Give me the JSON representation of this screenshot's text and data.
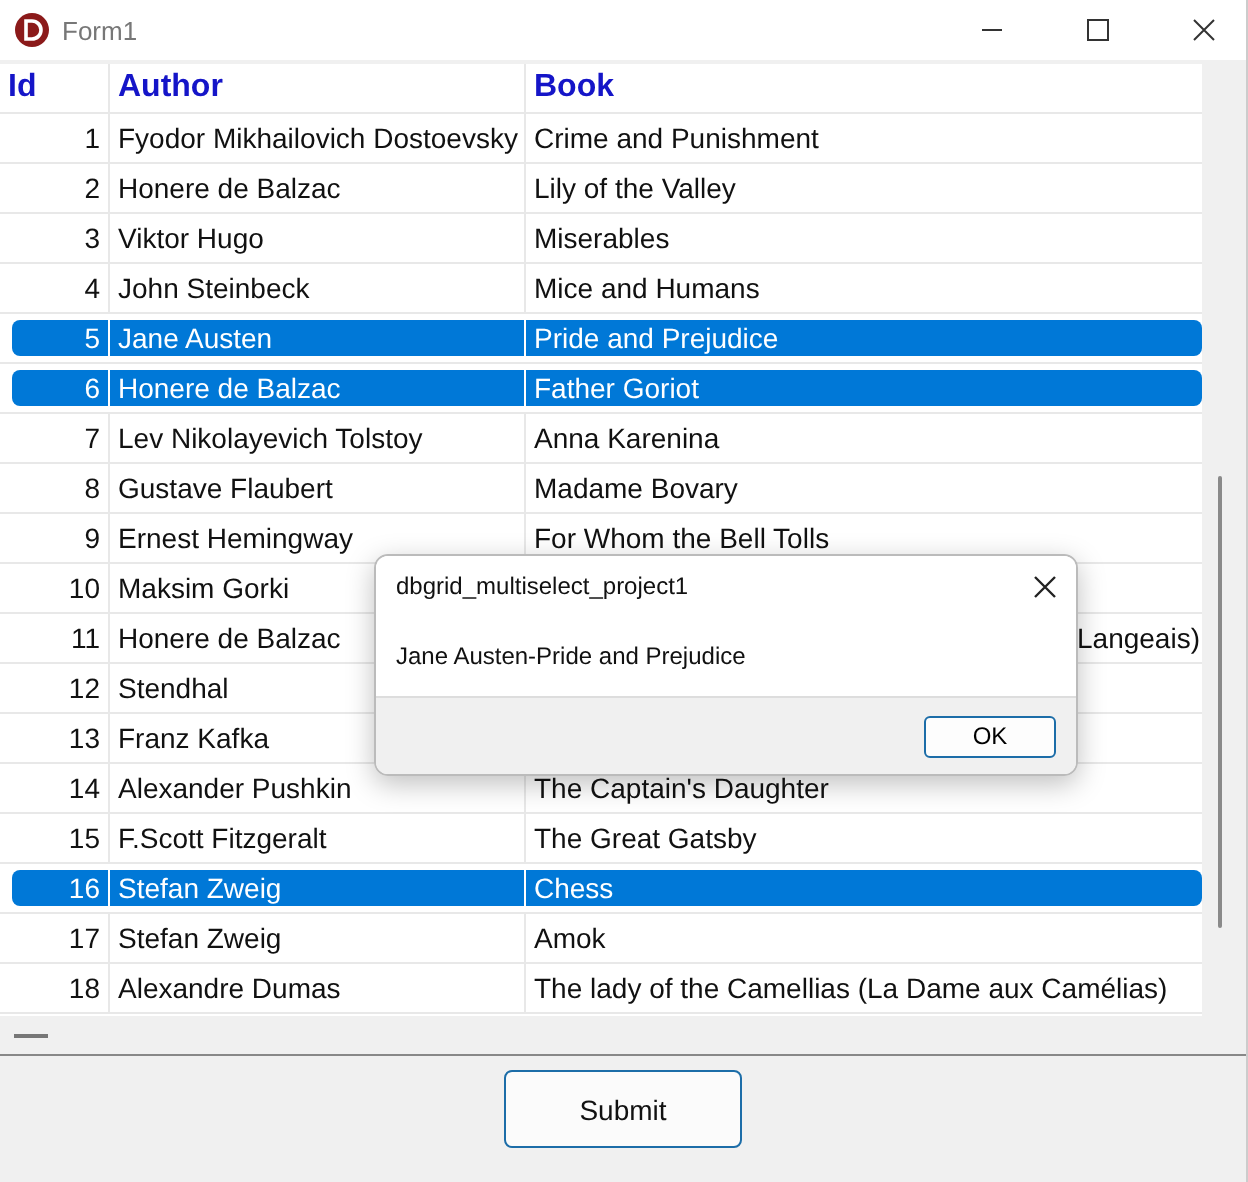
{
  "window": {
    "title": "Form1"
  },
  "grid": {
    "columns": [
      "Id",
      "Author",
      "Book"
    ],
    "rows": [
      {
        "id": "1",
        "author": "Fyodor Mikhailovich Dostoevsky",
        "book": "Crime and Punishment",
        "selected": false
      },
      {
        "id": "2",
        "author": "Honere de Balzac",
        "book": "Lily of the Valley",
        "selected": false
      },
      {
        "id": "3",
        "author": "Viktor Hugo",
        "book": "Miserables",
        "selected": false
      },
      {
        "id": "4",
        "author": "John Steinbeck",
        "book": "Mice and Humans",
        "selected": false
      },
      {
        "id": "5",
        "author": "Jane Austen",
        "book": "Pride and Prejudice",
        "selected": true
      },
      {
        "id": "6",
        "author": "Honere de Balzac",
        "book": "Father Goriot",
        "selected": true
      },
      {
        "id": "7",
        "author": "Lev Nikolayevich Tolstoy",
        "book": "Anna Karenina",
        "selected": false
      },
      {
        "id": "8",
        "author": "Gustave Flaubert",
        "book": "Madame Bovary",
        "selected": false
      },
      {
        "id": "9",
        "author": "Ernest Hemingway",
        "book": "For Whom the Bell Tolls",
        "selected": false
      },
      {
        "id": "10",
        "author": "Maksim Gorki",
        "selected": false
      },
      {
        "id": "11",
        "author": "Honere de Balzac",
        "book": "Langeais)",
        "book_partial": true,
        "selected": false
      },
      {
        "id": "12",
        "author": "Stendhal",
        "selected": false
      },
      {
        "id": "13",
        "author": "Franz Kafka",
        "selected": false
      },
      {
        "id": "14",
        "author": "Alexander Pushkin",
        "book": "The Captain's Daughter",
        "selected": false
      },
      {
        "id": "15",
        "author": "F.Scott Fitzgeralt",
        "book": "The Great Gatsby",
        "selected": false
      },
      {
        "id": "16",
        "author": "Stefan Zweig",
        "book": "Chess",
        "selected": true
      },
      {
        "id": "17",
        "author": "Stefan Zweig",
        "book": "Amok",
        "selected": false
      },
      {
        "id": "18",
        "author": "Alexandre Dumas",
        "book": "The lady of the Camellias (La Dame aux Camélias)",
        "selected": false
      }
    ]
  },
  "submit_button": "Submit",
  "dialog": {
    "title": "dbgrid_multiselect_project1",
    "message": "Jane Austen-Pride and Prejudice",
    "button": "OK"
  }
}
